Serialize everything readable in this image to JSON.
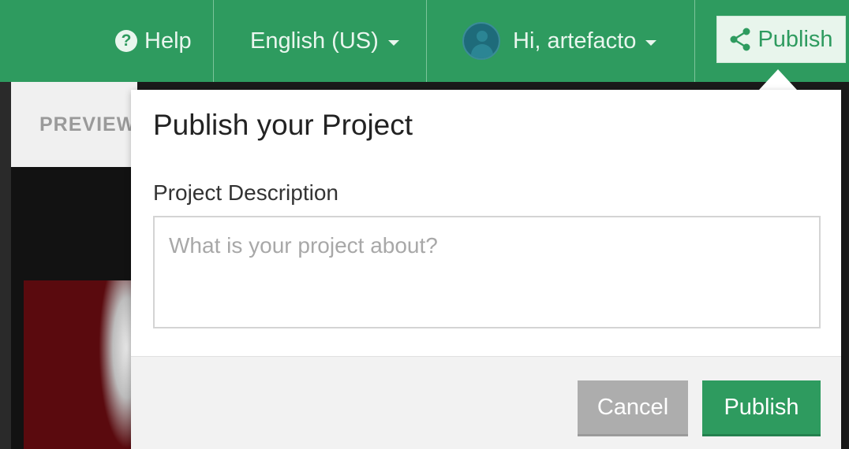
{
  "header": {
    "help_label": "Help",
    "help_icon": "question-circle-icon",
    "language": "English (US)",
    "greeting": "Hi, artefacto",
    "publish_label": "Publish",
    "publish_icon": "share-icon"
  },
  "background": {
    "preview_label": "PREVIEW"
  },
  "publish_dialog": {
    "title": "Publish your Project",
    "description_label": "Project Description",
    "description_placeholder": "What is your project about?",
    "description_value": "",
    "cancel_label": "Cancel",
    "publish_label": "Publish"
  },
  "colors": {
    "brand_green": "#2e9b5f",
    "cancel_gray": "#adadad"
  }
}
